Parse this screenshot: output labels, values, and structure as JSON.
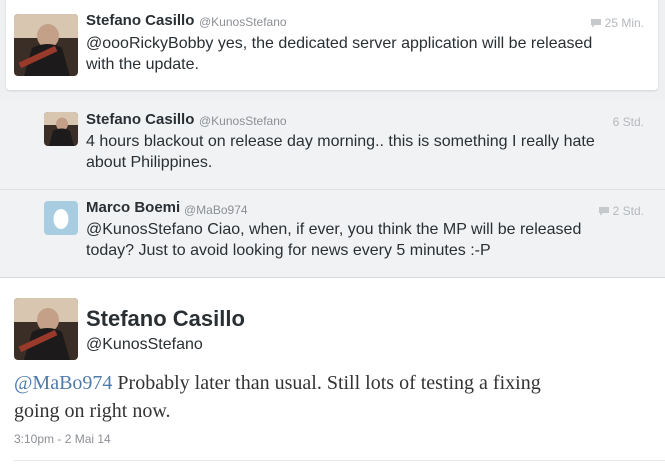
{
  "tweets": [
    {
      "name": "Stefano Casillo",
      "handle": "@KunosStefano",
      "time": "25 Min.",
      "has_reply_icon": true,
      "lines": [
        "@oooRickyBobby yes, the dedicated server application will be released",
        "with the update."
      ]
    },
    {
      "name": "Stefano Casillo",
      "handle": "@KunosStefano",
      "time": "6 Std.",
      "has_reply_icon": false,
      "lines": [
        "4 hours blackout on release day morning.. this is something I really hate",
        "about Philippines."
      ]
    },
    {
      "name": "Marco Boemi",
      "handle": "@MaBo974",
      "time": "2 Std.",
      "has_reply_icon": true,
      "lines": [
        "@KunosStefano Ciao, when, if ever, you think the MP will be released",
        "today? Just to avoid looking for news every 5 minutes :-P"
      ]
    }
  ],
  "detail": {
    "name": "Stefano Casillo",
    "handle": "@KunosStefano",
    "mention": "@MaBo974",
    "line1_rest": " Probably later than usual. Still lots of testing a fixing",
    "line2": "going on right now.",
    "timestamp": "3:10pm - 2 Mai 14"
  },
  "icons": {
    "reply": "speech-bubble-icon",
    "default_avatar": "egg-avatar-icon"
  },
  "colors": {
    "mention": "#4f7cab",
    "background": "#eef0f2",
    "avatar_egg_bg": "#a8cde0"
  }
}
